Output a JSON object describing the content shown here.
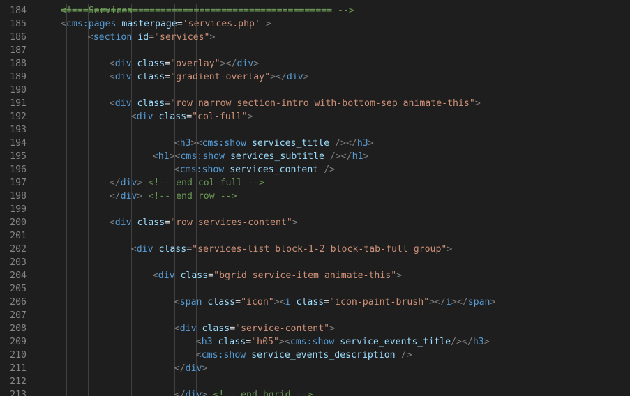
{
  "editor": {
    "partial_top_line": "<!-- Services",
    "lines": [
      {
        "num": "184",
        "indent": 0,
        "tokens": [
          {
            "c": "c",
            "t": "================================================= -->"
          }
        ]
      },
      {
        "num": "185",
        "indent": 0,
        "tokens": [
          {
            "c": "p",
            "t": "<"
          },
          {
            "c": "t",
            "t": "cms:pages"
          },
          {
            "c": "n",
            "t": " "
          },
          {
            "c": "a",
            "t": "masterpage"
          },
          {
            "c": "n",
            "t": "="
          },
          {
            "c": "s",
            "t": "'services.php'"
          },
          {
            "c": "n",
            "t": " "
          },
          {
            "c": "p",
            "t": ">"
          }
        ]
      },
      {
        "num": "186",
        "indent": 5,
        "tokens": [
          {
            "c": "p",
            "t": "<"
          },
          {
            "c": "t",
            "t": "section"
          },
          {
            "c": "n",
            "t": " "
          },
          {
            "c": "a",
            "t": "id"
          },
          {
            "c": "n",
            "t": "="
          },
          {
            "c": "s",
            "t": "\"services\""
          },
          {
            "c": "p",
            "t": ">"
          }
        ]
      },
      {
        "num": "187",
        "indent": 0,
        "tokens": []
      },
      {
        "num": "188",
        "indent": 9,
        "tokens": [
          {
            "c": "p",
            "t": "<"
          },
          {
            "c": "t",
            "t": "div"
          },
          {
            "c": "n",
            "t": " "
          },
          {
            "c": "a",
            "t": "class"
          },
          {
            "c": "n",
            "t": "="
          },
          {
            "c": "s",
            "t": "\"overlay\""
          },
          {
            "c": "p",
            "t": "></"
          },
          {
            "c": "t",
            "t": "div"
          },
          {
            "c": "p",
            "t": ">"
          }
        ]
      },
      {
        "num": "189",
        "indent": 9,
        "tokens": [
          {
            "c": "p",
            "t": "<"
          },
          {
            "c": "t",
            "t": "div"
          },
          {
            "c": "n",
            "t": " "
          },
          {
            "c": "a",
            "t": "class"
          },
          {
            "c": "n",
            "t": "="
          },
          {
            "c": "s",
            "t": "\"gradient-overlay\""
          },
          {
            "c": "p",
            "t": "></"
          },
          {
            "c": "t",
            "t": "div"
          },
          {
            "c": "p",
            "t": ">"
          }
        ]
      },
      {
        "num": "190",
        "indent": 0,
        "tokens": []
      },
      {
        "num": "191",
        "indent": 9,
        "tokens": [
          {
            "c": "p",
            "t": "<"
          },
          {
            "c": "t",
            "t": "div"
          },
          {
            "c": "n",
            "t": " "
          },
          {
            "c": "a",
            "t": "class"
          },
          {
            "c": "n",
            "t": "="
          },
          {
            "c": "s",
            "t": "\"row narrow section-intro with-bottom-sep animate-this\""
          },
          {
            "c": "p",
            "t": ">"
          }
        ]
      },
      {
        "num": "192",
        "indent": 13,
        "tokens": [
          {
            "c": "p",
            "t": "<"
          },
          {
            "c": "t",
            "t": "div"
          },
          {
            "c": "n",
            "t": " "
          },
          {
            "c": "a",
            "t": "class"
          },
          {
            "c": "n",
            "t": "="
          },
          {
            "c": "s",
            "t": "\"col-full\""
          },
          {
            "c": "p",
            "t": ">"
          }
        ]
      },
      {
        "num": "193",
        "indent": 0,
        "tokens": []
      },
      {
        "num": "194",
        "indent": 21,
        "tokens": [
          {
            "c": "p",
            "t": "<"
          },
          {
            "c": "t",
            "t": "h3"
          },
          {
            "c": "p",
            "t": "><"
          },
          {
            "c": "t",
            "t": "cms:show"
          },
          {
            "c": "n",
            "t": " "
          },
          {
            "c": "a",
            "t": "services_title"
          },
          {
            "c": "n",
            "t": " "
          },
          {
            "c": "p",
            "t": "/></"
          },
          {
            "c": "t",
            "t": "h3"
          },
          {
            "c": "p",
            "t": ">"
          }
        ]
      },
      {
        "num": "195",
        "indent": 17,
        "tokens": [
          {
            "c": "p",
            "t": "<"
          },
          {
            "c": "t",
            "t": "h1"
          },
          {
            "c": "p",
            "t": "><"
          },
          {
            "c": "t",
            "t": "cms:show"
          },
          {
            "c": "n",
            "t": " "
          },
          {
            "c": "a",
            "t": "services_subtitle"
          },
          {
            "c": "n",
            "t": " "
          },
          {
            "c": "p",
            "t": "/></"
          },
          {
            "c": "t",
            "t": "h1"
          },
          {
            "c": "p",
            "t": ">"
          }
        ]
      },
      {
        "num": "196",
        "indent": 21,
        "tokens": [
          {
            "c": "p",
            "t": "<"
          },
          {
            "c": "t",
            "t": "cms:show"
          },
          {
            "c": "n",
            "t": " "
          },
          {
            "c": "a",
            "t": "services_content"
          },
          {
            "c": "n",
            "t": " "
          },
          {
            "c": "p",
            "t": "/>"
          }
        ]
      },
      {
        "num": "197",
        "indent": 9,
        "tokens": [
          {
            "c": "p",
            "t": "</"
          },
          {
            "c": "t",
            "t": "div"
          },
          {
            "c": "p",
            "t": ">"
          },
          {
            "c": "n",
            "t": " "
          },
          {
            "c": "c",
            "t": "<!-- end col-full -->"
          }
        ]
      },
      {
        "num": "198",
        "indent": 9,
        "tokens": [
          {
            "c": "p",
            "t": "</"
          },
          {
            "c": "t",
            "t": "div"
          },
          {
            "c": "p",
            "t": ">"
          },
          {
            "c": "n",
            "t": " "
          },
          {
            "c": "c",
            "t": "<!-- end row -->"
          }
        ]
      },
      {
        "num": "199",
        "indent": 0,
        "tokens": []
      },
      {
        "num": "200",
        "indent": 9,
        "tokens": [
          {
            "c": "p",
            "t": "<"
          },
          {
            "c": "t",
            "t": "div"
          },
          {
            "c": "n",
            "t": " "
          },
          {
            "c": "a",
            "t": "class"
          },
          {
            "c": "n",
            "t": "="
          },
          {
            "c": "s",
            "t": "\"row services-content\""
          },
          {
            "c": "p",
            "t": ">"
          }
        ]
      },
      {
        "num": "201",
        "indent": 0,
        "tokens": []
      },
      {
        "num": "202",
        "indent": 13,
        "tokens": [
          {
            "c": "p",
            "t": "<"
          },
          {
            "c": "t",
            "t": "div"
          },
          {
            "c": "n",
            "t": " "
          },
          {
            "c": "a",
            "t": "class"
          },
          {
            "c": "n",
            "t": "="
          },
          {
            "c": "s",
            "t": "\"services-list block-1-2 block-tab-full group\""
          },
          {
            "c": "p",
            "t": ">"
          }
        ]
      },
      {
        "num": "203",
        "indent": 0,
        "tokens": []
      },
      {
        "num": "204",
        "indent": 17,
        "tokens": [
          {
            "c": "p",
            "t": "<"
          },
          {
            "c": "t",
            "t": "div"
          },
          {
            "c": "n",
            "t": " "
          },
          {
            "c": "a",
            "t": "class"
          },
          {
            "c": "n",
            "t": "="
          },
          {
            "c": "s",
            "t": "\"bgrid service-item animate-this\""
          },
          {
            "c": "p",
            "t": ">"
          }
        ]
      },
      {
        "num": "205",
        "indent": 0,
        "tokens": []
      },
      {
        "num": "206",
        "indent": 21,
        "tokens": [
          {
            "c": "p",
            "t": "<"
          },
          {
            "c": "t",
            "t": "span"
          },
          {
            "c": "n",
            "t": " "
          },
          {
            "c": "a",
            "t": "class"
          },
          {
            "c": "n",
            "t": "="
          },
          {
            "c": "s",
            "t": "\"icon\""
          },
          {
            "c": "p",
            "t": "><"
          },
          {
            "c": "t",
            "t": "i"
          },
          {
            "c": "n",
            "t": " "
          },
          {
            "c": "a",
            "t": "class"
          },
          {
            "c": "n",
            "t": "="
          },
          {
            "c": "s",
            "t": "\"icon-paint-brush\""
          },
          {
            "c": "p",
            "t": "></"
          },
          {
            "c": "t",
            "t": "i"
          },
          {
            "c": "p",
            "t": "></"
          },
          {
            "c": "t",
            "t": "span"
          },
          {
            "c": "p",
            "t": ">"
          }
        ]
      },
      {
        "num": "207",
        "indent": 0,
        "tokens": []
      },
      {
        "num": "208",
        "indent": 21,
        "tokens": [
          {
            "c": "p",
            "t": "<"
          },
          {
            "c": "t",
            "t": "div"
          },
          {
            "c": "n",
            "t": " "
          },
          {
            "c": "a",
            "t": "class"
          },
          {
            "c": "n",
            "t": "="
          },
          {
            "c": "s",
            "t": "\"service-content\""
          },
          {
            "c": "p",
            "t": ">"
          }
        ]
      },
      {
        "num": "209",
        "indent": 25,
        "tokens": [
          {
            "c": "p",
            "t": "<"
          },
          {
            "c": "t",
            "t": "h3"
          },
          {
            "c": "n",
            "t": " "
          },
          {
            "c": "a",
            "t": "class"
          },
          {
            "c": "n",
            "t": "="
          },
          {
            "c": "s",
            "t": "\"h05\""
          },
          {
            "c": "p",
            "t": "><"
          },
          {
            "c": "t",
            "t": "cms:show"
          },
          {
            "c": "n",
            "t": " "
          },
          {
            "c": "a",
            "t": "service_events_title"
          },
          {
            "c": "p",
            "t": "/></"
          },
          {
            "c": "t",
            "t": "h3"
          },
          {
            "c": "p",
            "t": ">"
          }
        ]
      },
      {
        "num": "210",
        "indent": 25,
        "tokens": [
          {
            "c": "p",
            "t": "<"
          },
          {
            "c": "t",
            "t": "cms:show"
          },
          {
            "c": "n",
            "t": " "
          },
          {
            "c": "a",
            "t": "service_events_description"
          },
          {
            "c": "n",
            "t": " "
          },
          {
            "c": "p",
            "t": "/>"
          }
        ]
      },
      {
        "num": "211",
        "indent": 21,
        "tokens": [
          {
            "c": "p",
            "t": "</"
          },
          {
            "c": "t",
            "t": "div"
          },
          {
            "c": "p",
            "t": ">"
          }
        ]
      },
      {
        "num": "212",
        "indent": 0,
        "tokens": []
      },
      {
        "num": "213",
        "indent": 21,
        "tokens": [
          {
            "c": "p",
            "t": "</"
          },
          {
            "c": "t",
            "t": "div"
          },
          {
            "c": "p",
            "t": ">"
          },
          {
            "c": "n",
            "t": " "
          },
          {
            "c": "c",
            "t": "<!-- end bgrid -->"
          }
        ]
      }
    ]
  }
}
